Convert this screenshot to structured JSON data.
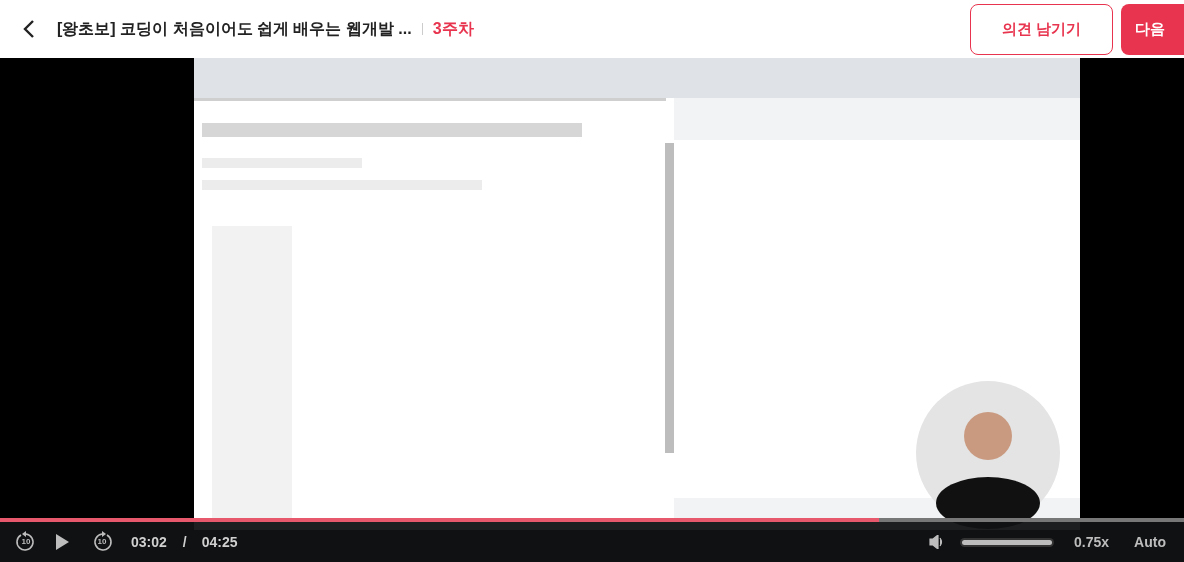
{
  "header": {
    "title": "[왕초보] 코딩이 처음이어도 쉽게 배우는 웹개발 ...",
    "week": "3주차",
    "buttons": [
      {
        "label": "의견 남기기",
        "kind": "outline"
      },
      {
        "label": "다음",
        "kind": "filled"
      }
    ]
  },
  "player": {
    "progress": {
      "level": 0.742
    },
    "skip_back": "10",
    "skip_forward": "10",
    "playing": false,
    "current_time": "03:02",
    "separator": "/",
    "duration": "04:25",
    "volume": {
      "level": 1
    },
    "speed": "0.75x",
    "quality": "Auto"
  }
}
